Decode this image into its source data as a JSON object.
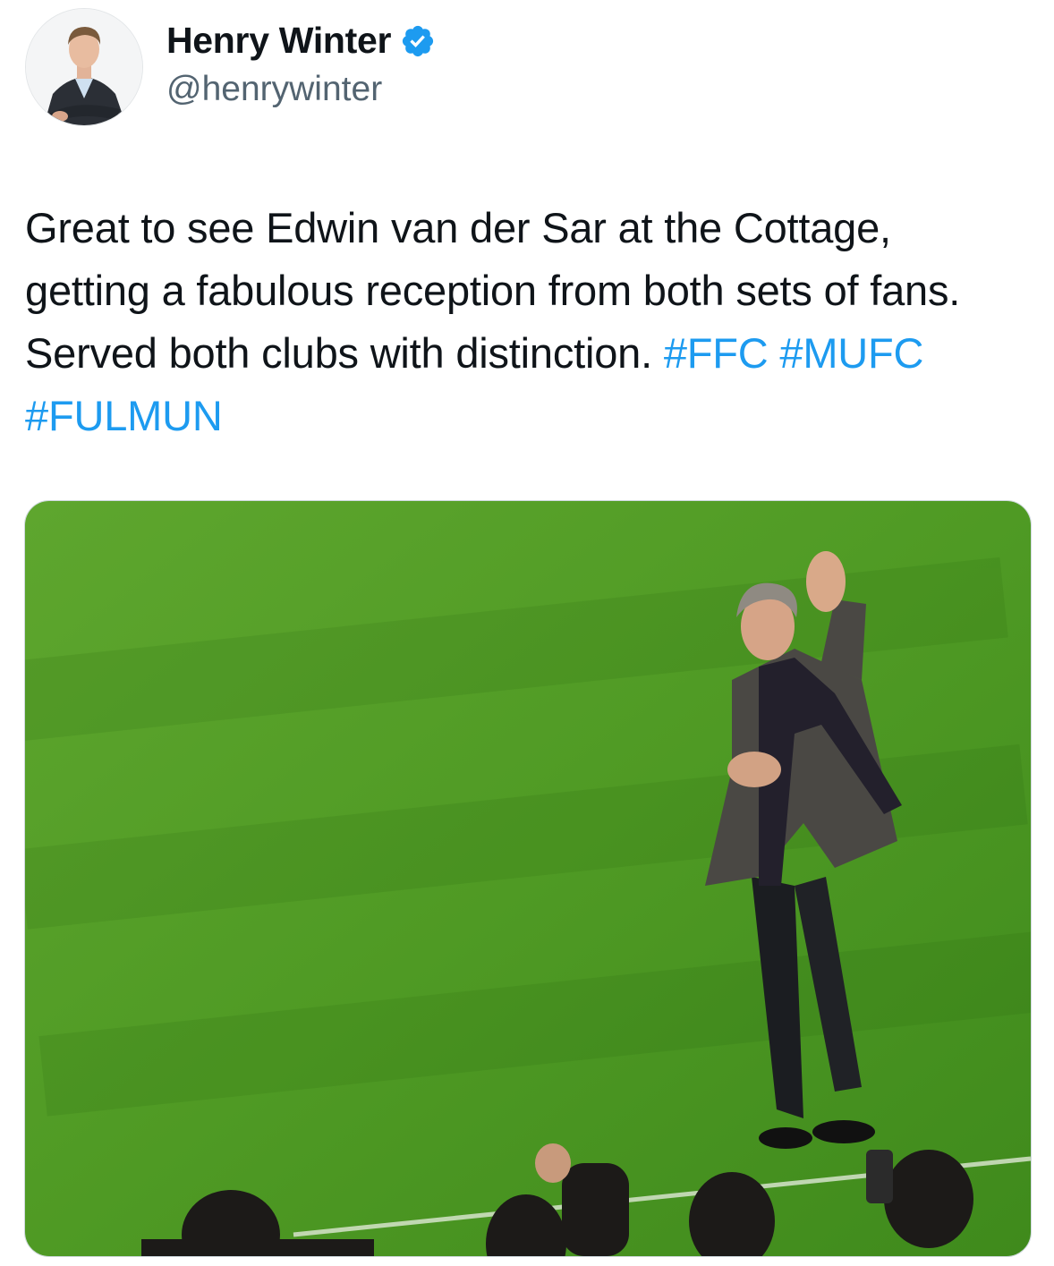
{
  "author": {
    "display_name": "Henry Winter",
    "handle": "@henrywinter",
    "verified_icon": "verified-badge-icon",
    "verified_color": "#1d9bf0",
    "avatar": "profile-photo-man-in-suit"
  },
  "tweet": {
    "text_plain": "Great to see Edwin van der Sar at the Cottage, getting a fabulous reception from both sets of fans. Served both clubs with distinction.",
    "hashtags": [
      "#FFC",
      "#MUFC",
      "#FULMUN"
    ],
    "hashtag_color": "#1d9bf0"
  },
  "media": {
    "kind": "photo",
    "subject": "man-waving-on-football-pitch"
  }
}
